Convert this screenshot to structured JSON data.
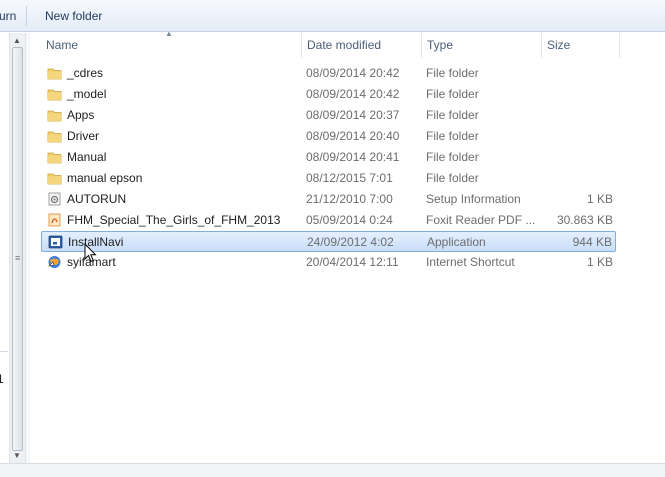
{
  "toolbar": {
    "burn_fragment": "urn",
    "new_folder_label": "New folder"
  },
  "nav": {
    "fragment": "1"
  },
  "columns": {
    "name": "Name",
    "date": "Date modified",
    "type": "Type",
    "size": "Size"
  },
  "files": [
    {
      "name": "_cdres",
      "date": "08/09/2014 20:42",
      "type": "File folder",
      "size": "",
      "icon": "folder-icon"
    },
    {
      "name": "_model",
      "date": "08/09/2014 20:42",
      "type": "File folder",
      "size": "",
      "icon": "folder-icon"
    },
    {
      "name": "Apps",
      "date": "08/09/2014 20:37",
      "type": "File folder",
      "size": "",
      "icon": "folder-icon"
    },
    {
      "name": "Driver",
      "date": "08/09/2014 20:40",
      "type": "File folder",
      "size": "",
      "icon": "folder-icon"
    },
    {
      "name": "Manual",
      "date": "08/09/2014 20:41",
      "type": "File folder",
      "size": "",
      "icon": "folder-icon"
    },
    {
      "name": "manual epson",
      "date": "08/12/2015 7:01",
      "type": "File folder",
      "size": "",
      "icon": "folder-icon"
    },
    {
      "name": "AUTORUN",
      "date": "21/12/2010 7:00",
      "type": "Setup Information",
      "size": "1 KB",
      "icon": "setup-info-icon"
    },
    {
      "name": "FHM_Special_The_Girls_of_FHM_2013",
      "date": "05/09/2014 0:24",
      "type": "Foxit Reader PDF ...",
      "size": "30.863 KB",
      "icon": "pdf-icon"
    },
    {
      "name": "InstallNavi",
      "date": "24/09/2012 4:02",
      "type": "Application",
      "size": "944 KB",
      "icon": "application-icon",
      "selected": true
    },
    {
      "name": "syifamart",
      "date": "20/04/2014 12:11",
      "type": "Internet Shortcut",
      "size": "1 KB",
      "icon": "internet-shortcut-icon"
    }
  ],
  "colors": {
    "selection": "#cce1fb",
    "selection_border": "#84acdd",
    "folder": "#e8c35a",
    "header_text": "#4c607a"
  }
}
